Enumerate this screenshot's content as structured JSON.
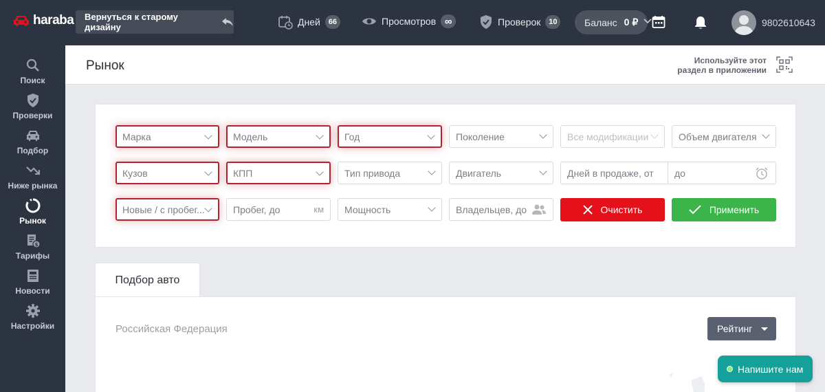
{
  "brand": {
    "name": "haraba"
  },
  "topbar": {
    "back_label": "Вернуться к старому дизайну",
    "days_label": "Дней",
    "days_count": "66",
    "views_label": "Просмотров",
    "views_count": "∞",
    "checks_label": "Проверок",
    "checks_count": "10",
    "balance_label": "Баланс",
    "balance_value": "0 ₽",
    "user_id": "9802610643"
  },
  "sidebar": {
    "items": [
      {
        "label": "Поиск",
        "icon": "search-icon"
      },
      {
        "label": "Проверки",
        "icon": "shield-check-icon"
      },
      {
        "label": "Подбор",
        "icon": "car-icon"
      },
      {
        "label": "Ниже рынка",
        "icon": "trend-down-icon"
      },
      {
        "label": "Рынок",
        "icon": "market-icon",
        "active": true
      },
      {
        "label": "Тарифы",
        "icon": "tariffs-icon"
      },
      {
        "label": "Новости",
        "icon": "news-icon"
      },
      {
        "label": "Настройки",
        "icon": "gear-icon"
      }
    ]
  },
  "header": {
    "title": "Рынок",
    "app_note_line1": "Используйте этот",
    "app_note_line2": "раздел в приложении"
  },
  "filters": {
    "brand": "Марка",
    "model": "Модель",
    "year": "Год",
    "generation": "Поколение",
    "modifications": "Все модификации",
    "engine_volume": "Объем двигателя",
    "body": "Кузов",
    "gearbox": "КПП",
    "drive": "Тип привода",
    "engine": "Двигатель",
    "days_from": "Дней в продаже, от",
    "days_to": "до",
    "condition": "Новые / с пробег...",
    "mileage": "Пробег, до",
    "mileage_unit": "км",
    "power": "Мощность",
    "owners": "Владельцев, до",
    "clear_label": "Очистить",
    "apply_label": "Применить"
  },
  "colors": {
    "clear": "#e4111b",
    "apply": "#3bb54a",
    "highlight": "#b3232f",
    "chat": "#16a09a"
  },
  "tabs": [
    {
      "label": "Подбор авто"
    }
  ],
  "content": {
    "region": "Российская Федерация",
    "sort_label": "Рейтинг"
  },
  "chat": {
    "label": "Напишите нам"
  }
}
